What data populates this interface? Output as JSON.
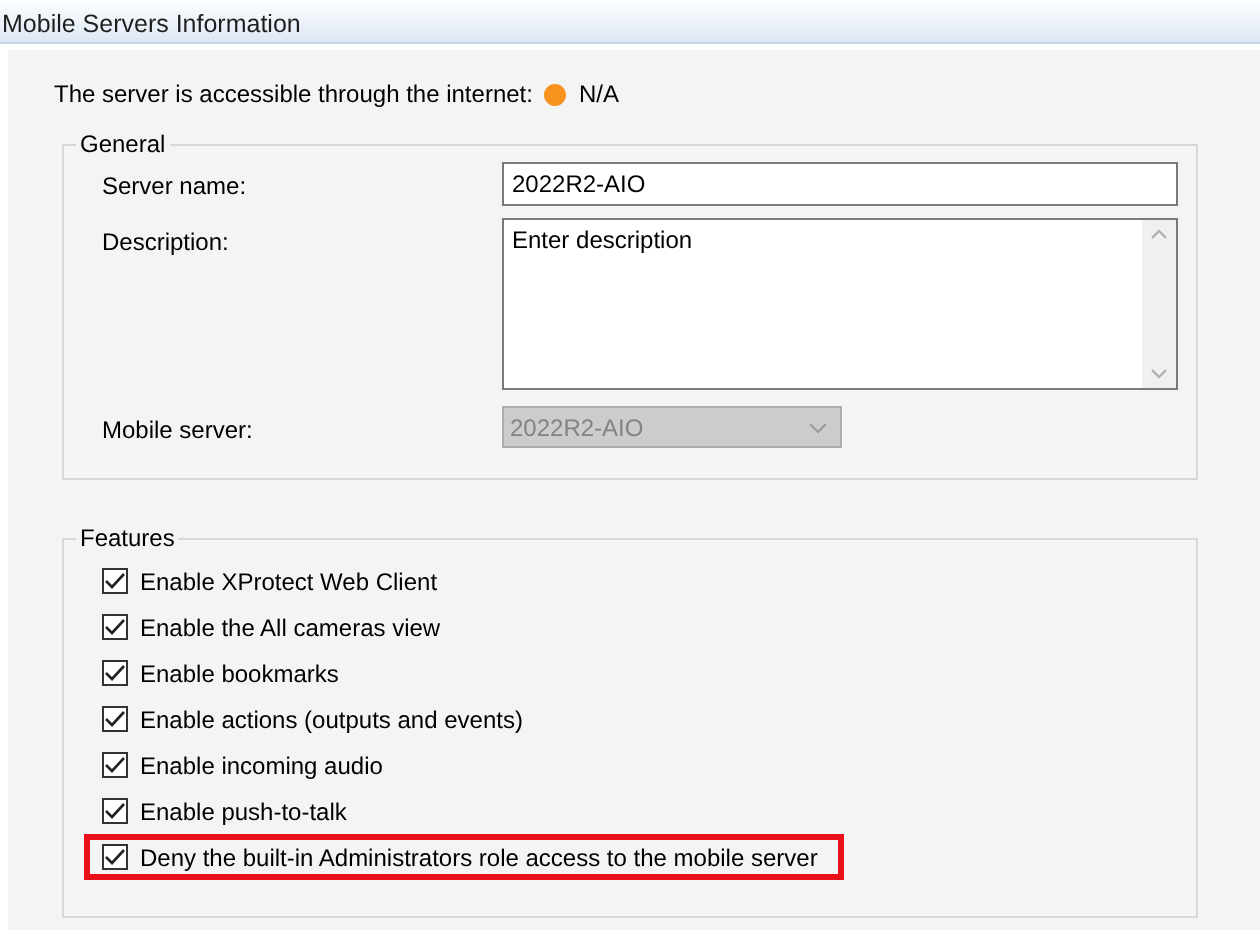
{
  "window": {
    "title": "Mobile Servers Information"
  },
  "status": {
    "label": "The server is accessible through the internet:",
    "color": "#f7931e",
    "value": "N/A"
  },
  "general": {
    "title": "General",
    "server_name": {
      "label": "Server name:",
      "value": "2022R2-AIO"
    },
    "description": {
      "label": "Description:",
      "value": "Enter description"
    },
    "mobile_server": {
      "label": "Mobile server:",
      "value": "2022R2-AIO",
      "disabled": true
    }
  },
  "features": {
    "title": "Features",
    "items": [
      {
        "label": "Enable XProtect Web Client",
        "checked": true,
        "highlighted": false
      },
      {
        "label": "Enable the All cameras view",
        "checked": true,
        "highlighted": false
      },
      {
        "label": "Enable bookmarks",
        "checked": true,
        "highlighted": false
      },
      {
        "label": "Enable actions (outputs and events)",
        "checked": true,
        "highlighted": false
      },
      {
        "label": "Enable incoming audio",
        "checked": true,
        "highlighted": false
      },
      {
        "label": "Enable push-to-talk",
        "checked": true,
        "highlighted": false
      },
      {
        "label": "Deny the built-in Administrators role access to the mobile server",
        "checked": true,
        "highlighted": true
      }
    ]
  }
}
